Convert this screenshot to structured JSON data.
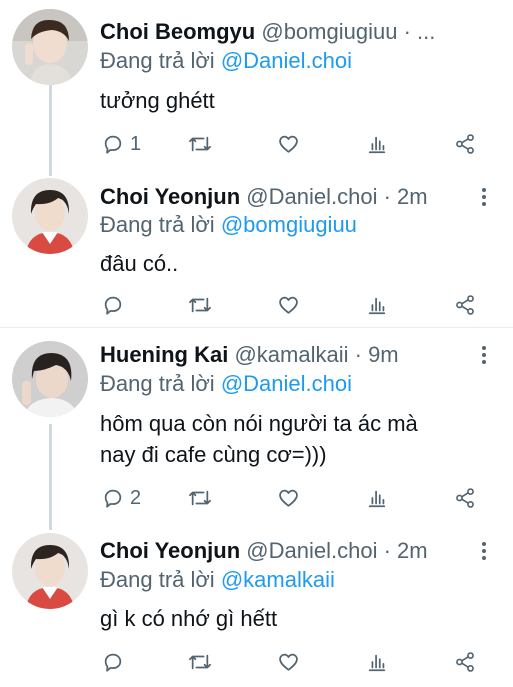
{
  "tweets": [
    {
      "name": "Choi Beomgyu",
      "handle": "@bomgiugiuu",
      "meta": "· ...",
      "reply_prefix": "Đang trả lời",
      "reply_to": "@Daniel.choi",
      "text": "tưởng ghétt",
      "reply_count": "1",
      "avatar_icon": "person-avatar"
    },
    {
      "name": "Choi Yeonjun",
      "handle": "@Daniel.choi",
      "meta": "· 2m",
      "reply_prefix": "Đang trả lời",
      "reply_to": "@bomgiugiuu",
      "text": "đâu có..",
      "reply_count": "",
      "avatar_icon": "person-avatar"
    },
    {
      "name": "Huening Kai",
      "handle": "@kamalkaii",
      "meta": "· 9m",
      "reply_prefix": "Đang trả lời",
      "reply_to": "@Daniel.choi",
      "text": "hôm qua còn nói người ta ác mà\nnay đi cafe cùng cơ=)))",
      "reply_count": "2",
      "avatar_icon": "person-avatar"
    },
    {
      "name": "Choi Yeonjun",
      "handle": "@Daniel.choi",
      "meta": "· 2m",
      "reply_prefix": "Đang trả lời",
      "reply_to": "@kamalkaii",
      "text": "gì k có nhớ gì hếtt",
      "reply_count": "",
      "avatar_icon": "person-avatar"
    }
  ],
  "icons": {
    "reply": "reply-icon",
    "retweet": "retweet-icon",
    "like": "heart-icon",
    "analytics": "analytics-icon",
    "share": "share-icon",
    "more": "more-options-icon"
  },
  "colors": {
    "text": "#0f1419",
    "secondary": "#536471",
    "mention": "#1d9bf0",
    "thread_line": "#cfd9de"
  }
}
